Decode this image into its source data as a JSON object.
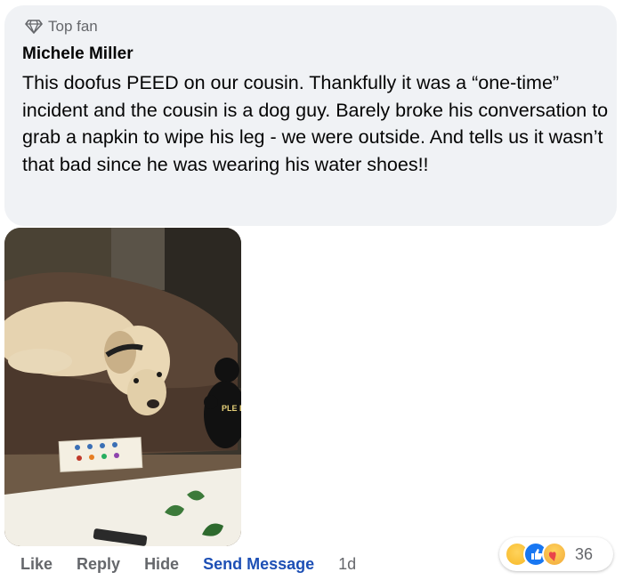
{
  "comment": {
    "badge": "Top fan",
    "author": "Michele Miller",
    "text": "This doofus PEED on our cousin. Thankfully it was a “one-time” incident and the cousin is a dog guy. Barely broke his conversation to grab a napkin to wipe his leg - we were outside. And tells us it wasn’t that bad since he was wearing his water shoes!!",
    "image_sign_text": "PLE DON'T THE"
  },
  "actions": {
    "like": "Like",
    "reply": "Reply",
    "hide": "Hide",
    "send_message": "Send Message",
    "time": "1d"
  },
  "reactions": {
    "icons": [
      "haha-icon",
      "like-icon",
      "care-icon"
    ],
    "count": "36"
  },
  "colors": {
    "bubble": "#f0f2f5",
    "muted_text": "#65676b",
    "link_blue": "#1d4fb5",
    "like_blue": "#1877f2",
    "haha_yellow": "#f7b928"
  }
}
